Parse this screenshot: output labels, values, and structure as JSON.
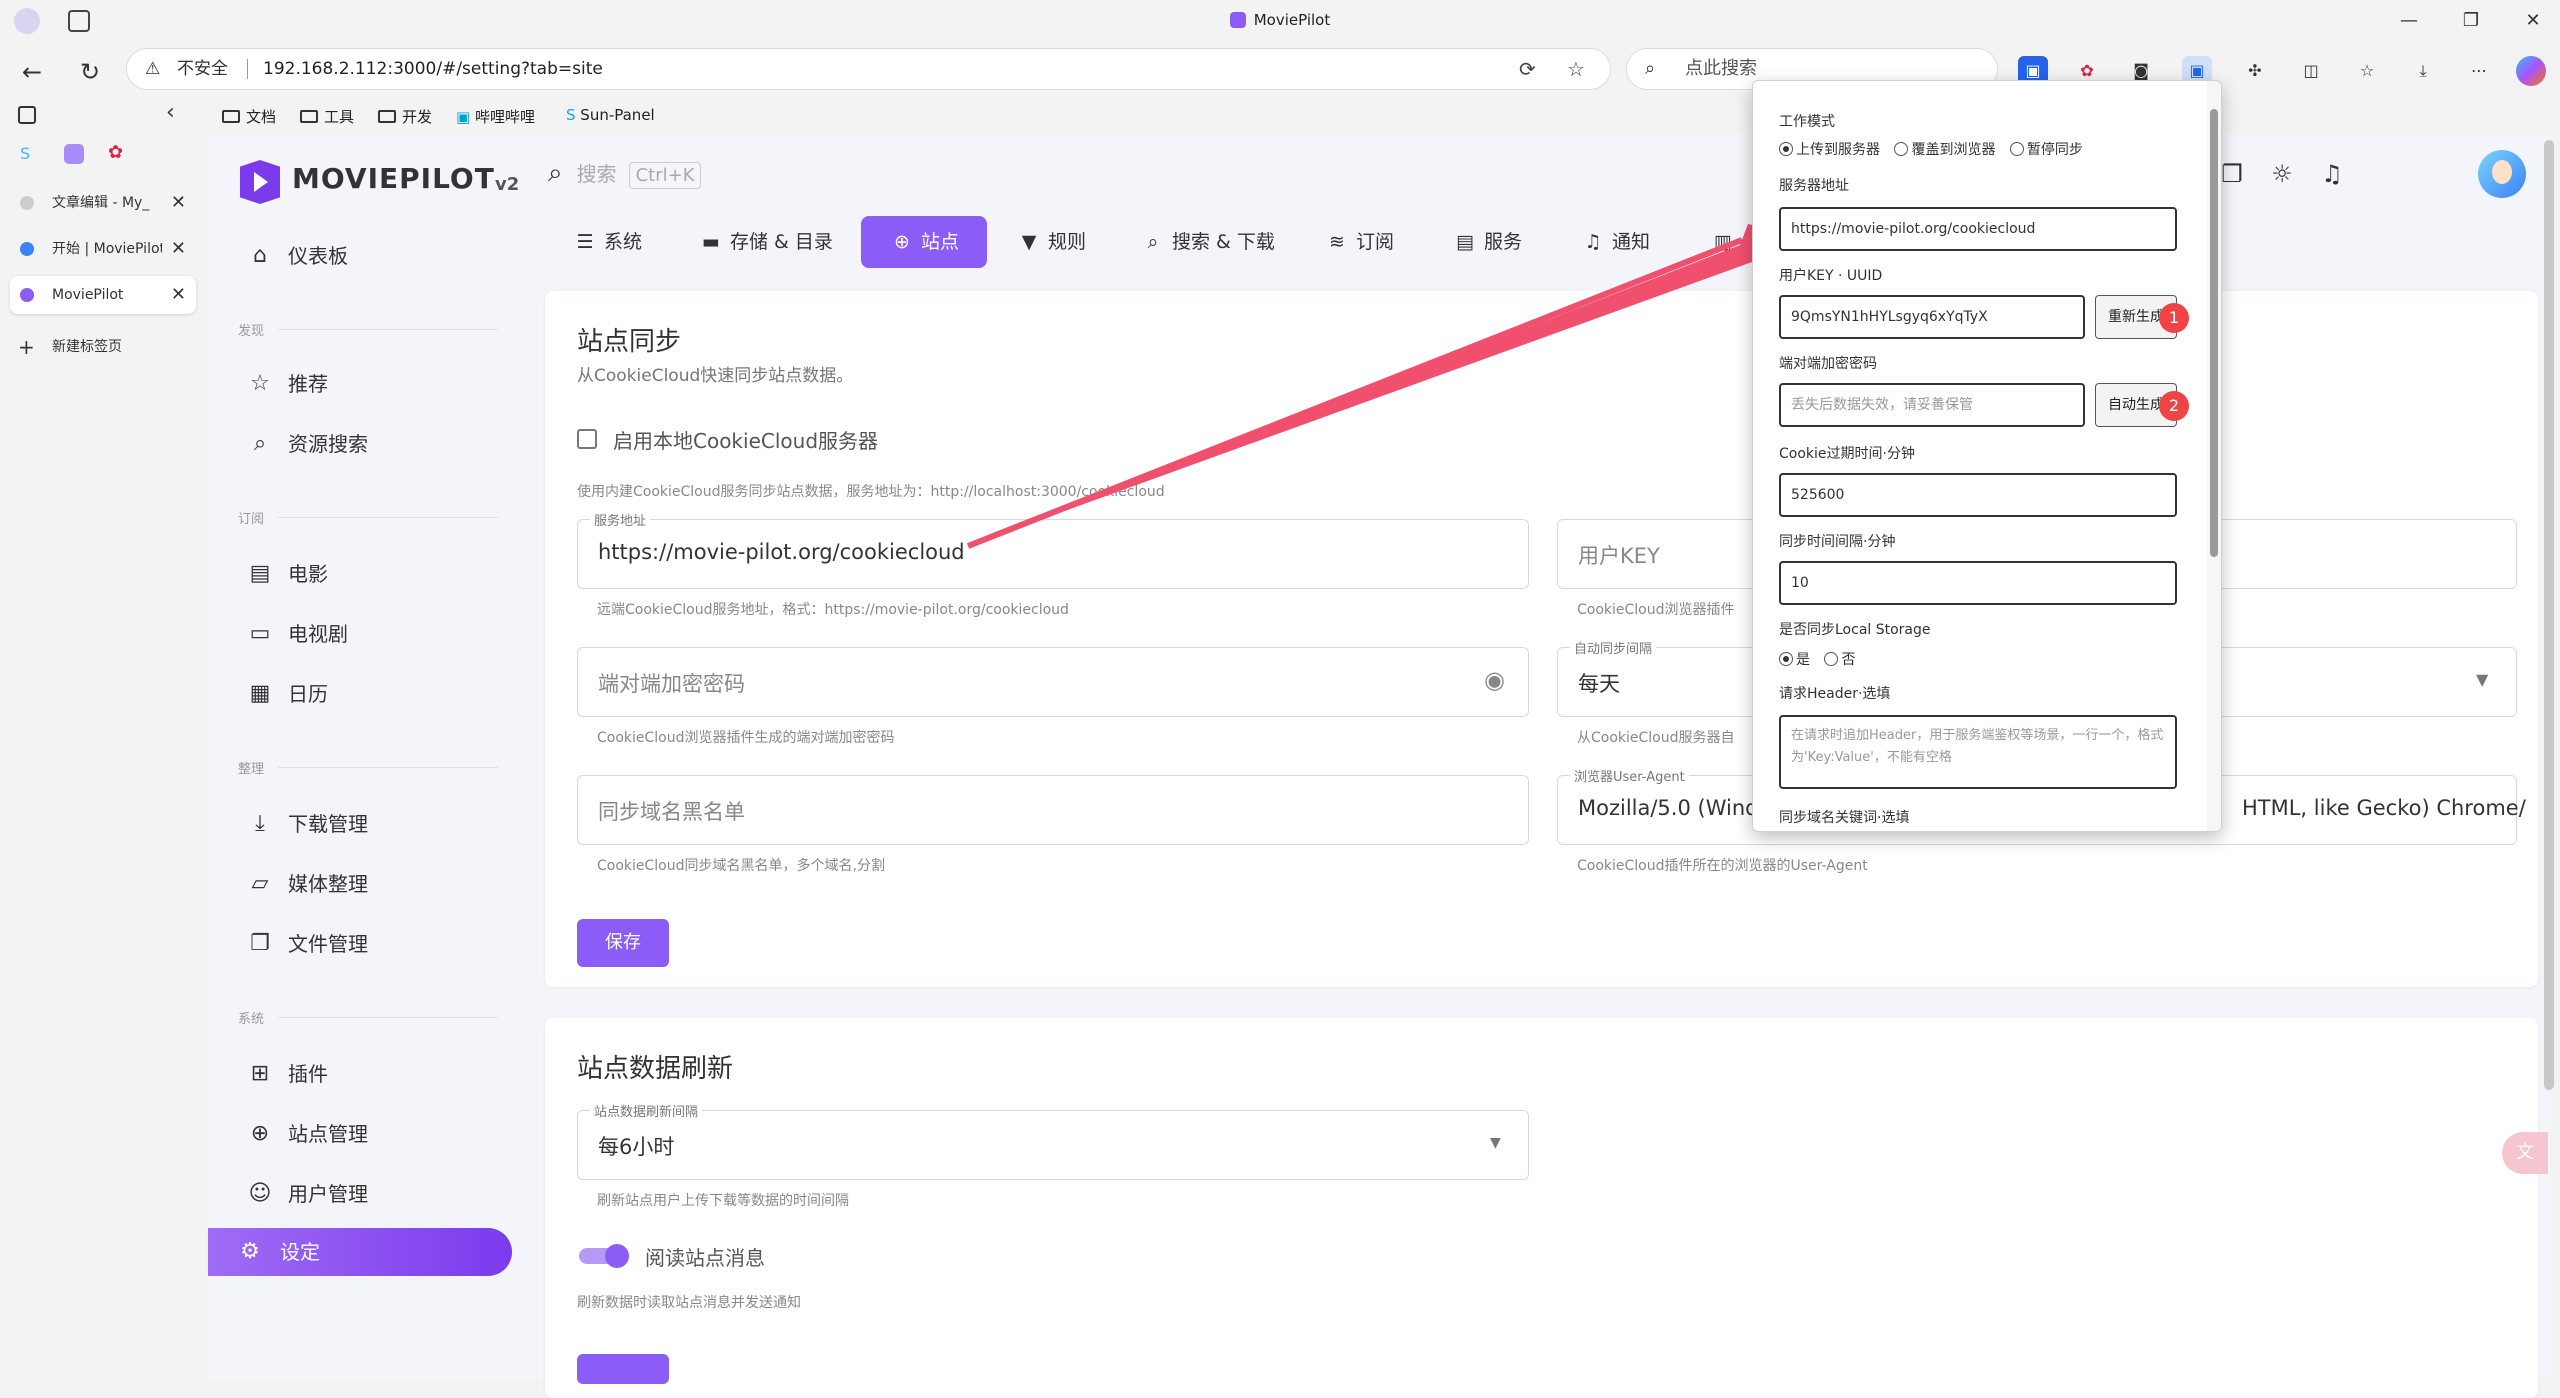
{
  "browser": {
    "window_title": "MoviePilot",
    "url_security": "不安全",
    "url": "192.168.2.112:3000/#/setting?tab=site",
    "search_placeholder": "点此搜索",
    "bookmarks": [
      "文档",
      "工具",
      "开发",
      "哔哩哔哩",
      "Sun-Panel"
    ],
    "tabs": [
      {
        "label": "文章编辑 - My_",
        "active": false
      },
      {
        "label": "开始 | MoviePilot",
        "active": false
      },
      {
        "label": "MoviePilot",
        "active": true
      }
    ],
    "new_tab": "新建标签页"
  },
  "app": {
    "logo_name": "MOVIEPILOT",
    "logo_version": "v2",
    "search_placeholder": "搜索",
    "search_shortcut": "Ctrl+K",
    "sidebar": {
      "dashboard": "仪表板",
      "sections": [
        {
          "title": "发现",
          "items": [
            "推荐",
            "资源搜索"
          ]
        },
        {
          "title": "订阅",
          "items": [
            "电影",
            "电视剧",
            "日历"
          ]
        },
        {
          "title": "整理",
          "items": [
            "下载管理",
            "媒体整理",
            "文件管理"
          ]
        },
        {
          "title": "系统",
          "items": [
            "插件",
            "站点管理",
            "用户管理",
            "设定"
          ]
        }
      ],
      "active_item": "设定"
    },
    "settings_tabs": [
      "系统",
      "存储 & 目录",
      "站点",
      "规则",
      "搜索 & 下载",
      "订阅",
      "服务",
      "通知"
    ],
    "active_tab": "站点"
  },
  "site_sync": {
    "title": "站点同步",
    "subtitle": "从CookieCloud快速同步站点数据。",
    "local_server_label": "启用本地CookieCloud服务器",
    "local_server_checked": false,
    "local_server_hint": "使用内建CookieCloud服务同步站点数据，服务地址为：http://localhost:3000/cookiecloud",
    "server_label": "服务地址",
    "server_value": "https://movie-pilot.org/cookiecloud",
    "server_hint": "远端CookieCloud服务地址，格式：https://movie-pilot.org/cookiecloud",
    "user_key_placeholder": "用户KEY",
    "user_key_hint": "CookieCloud浏览器插件",
    "password_placeholder": "端对端加密密码",
    "password_hint": "CookieCloud浏览器插件生成的端对端加密密码",
    "interval_label": "自动同步间隔",
    "interval_value": "每天",
    "interval_hint": "从CookieCloud服务器自",
    "blacklist_placeholder": "同步域名黑名单",
    "blacklist_hint": "CookieCloud同步域名黑名单，多个域名,分割",
    "ua_label": "浏览器User-Agent",
    "ua_value_left": "Mozilla/5.0 (Wind",
    "ua_value_right": "HTML, like Gecko) Chrome/",
    "ua_hint": "CookieCloud插件所在的浏览器的User-Agent",
    "save_label": "保存"
  },
  "site_refresh": {
    "title": "站点数据刷新",
    "interval_label": "站点数据刷新间隔",
    "interval_value": "每6小时",
    "interval_hint": "刷新站点用户上传下载等数据的时间间隔",
    "read_msg_label": "阅读站点消息",
    "read_msg_on": true,
    "read_msg_hint": "刷新数据时读取站点消息并发送通知"
  },
  "popup": {
    "mode_label": "工作模式",
    "mode_options": [
      "上传到服务器",
      "覆盖到浏览器",
      "暂停同步"
    ],
    "mode_selected": "上传到服务器",
    "server_label": "服务器地址",
    "server_value": "https://movie-pilot.org/cookiecloud",
    "uuid_label": "用户KEY · UUID",
    "uuid_value": "9QmsYN1hHYLsgyq6xYqTyX",
    "regen_label": "重新生成",
    "password_label": "端对端加密密码",
    "password_placeholder": "丢失后数据失效，请妥善保管",
    "autogen_label": "自动生成",
    "badge_1": "1",
    "badge_2": "2",
    "expire_label": "Cookie过期时间·分钟",
    "expire_value": "525600",
    "interval_label": "同步时间间隔·分钟",
    "interval_value": "10",
    "local_storage_label": "是否同步Local Storage",
    "local_storage_options": [
      "是",
      "否"
    ],
    "local_storage_selected": "是",
    "header_label": "请求Header·选填",
    "header_placeholder": "在请求时追加Header，用于服务端鉴权等场景，一行一个，格式为'Key:Value'，不能有空格",
    "keywords_label": "同步域名关键词·选填"
  }
}
